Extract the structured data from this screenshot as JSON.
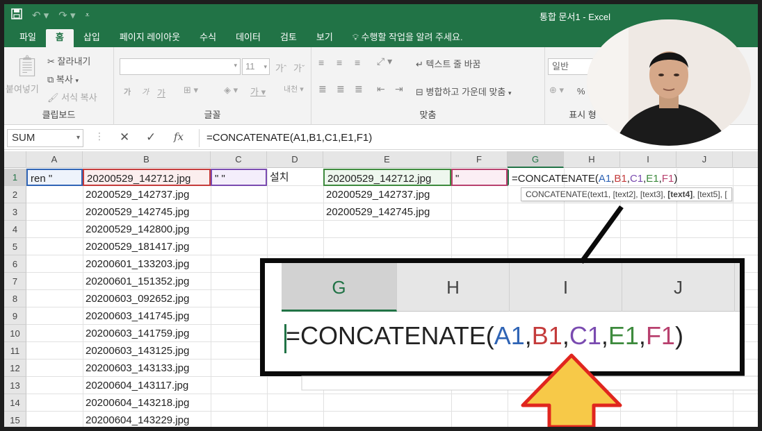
{
  "window": {
    "title": "통합 문서1 - Excel"
  },
  "ribbon_tabs": [
    "파일",
    "홈",
    "삽입",
    "페이지 레이아웃",
    "수식",
    "데이터",
    "검토",
    "보기"
  ],
  "active_tab": "홈",
  "tell_me": "수행할 작업을 알려 주세요.",
  "clipboard": {
    "paste": "붙여넣기",
    "cut": "잘라내기",
    "copy": "복사",
    "format_painter": "서식 복사",
    "label": "클립보드"
  },
  "font": {
    "size": "11",
    "bold": "가",
    "italic": "가",
    "underline": "가",
    "label": "글꼴",
    "color_glyph": "가",
    "phonetic": "내천"
  },
  "alignment": {
    "wrap": "텍스트 줄 바꿈",
    "merge": "병합하고 가운데 맞춤",
    "label": "맞춤"
  },
  "number": {
    "format": "일반",
    "percent": "%",
    "label": "표시 형"
  },
  "formula_bar": {
    "name_box": "SUM",
    "fx": "fx",
    "cancel": "✕",
    "enter": "✓",
    "formula": "=CONCATENATE(A1,B1,C1,E1,F1)"
  },
  "columns": [
    "A",
    "B",
    "C",
    "D",
    "E",
    "F",
    "G",
    "H",
    "I",
    "J"
  ],
  "rows": [
    "1",
    "2",
    "3",
    "4",
    "5",
    "6",
    "7",
    "8",
    "9",
    "10",
    "11",
    "12",
    "13",
    "14",
    "15"
  ],
  "cells": {
    "A1": "ren \"",
    "C1": "\" \"",
    "D1": "설치",
    "F1": "\"",
    "B": [
      "20200529_142712.jpg",
      "20200529_142737.jpg",
      "20200529_142745.jpg",
      "20200529_142800.jpg",
      "20200529_181417.jpg",
      "20200601_133203.jpg",
      "20200601_151352.jpg",
      "20200603_092652.jpg",
      "20200603_141745.jpg",
      "20200603_141759.jpg",
      "20200603_143125.jpg",
      "20200603_143133.jpg",
      "20200604_143117.jpg",
      "20200604_143218.jpg",
      "20200604_143229.jpg"
    ],
    "E": [
      "20200529_142712.jpg",
      "20200529_142737.jpg",
      "20200529_142745.jpg"
    ]
  },
  "g1_formula": {
    "prefix": "=CONCATENATE(",
    "a": "A1",
    "b": "B1",
    "c": "C1",
    "e": "E1",
    "f": "F1",
    "comma": ",",
    "close": ")"
  },
  "tooltip": {
    "text_start": "CONCATENATE(text1, [text2], [text3], ",
    "bold": "[text4]",
    "text_end": ", [text5], ["
  },
  "zoom": {
    "columns": [
      "G",
      "H",
      "I",
      "J"
    ]
  },
  "colors": {
    "excel_green": "#217346",
    "ref_a": "#2f64b5",
    "ref_b": "#c43b3b",
    "ref_c": "#7a4bb0",
    "ref_e": "#3d8a3d",
    "ref_f": "#b8406e",
    "arrow_fill": "#f7c948",
    "arrow_stroke": "#e0261e"
  }
}
